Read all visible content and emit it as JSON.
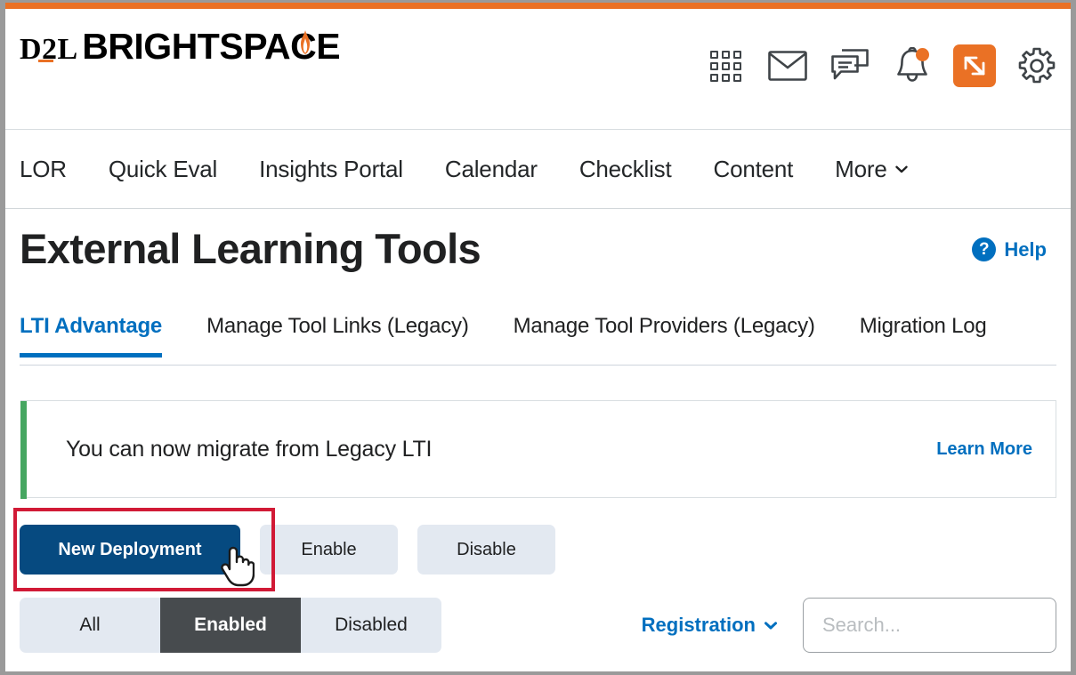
{
  "brand": {
    "logo_primary": "D2L",
    "logo_secondary": "BRIGHTSPACE",
    "accent_color": "#ea7125"
  },
  "header": {
    "icons": [
      {
        "name": "waffle-grid-icon",
        "label": "Course Selector"
      },
      {
        "name": "envelope-icon",
        "label": "Email"
      },
      {
        "name": "chat-bubbles-icon",
        "label": "Subscriptions"
      },
      {
        "name": "bell-icon",
        "label": "Notifications",
        "badge": true
      },
      {
        "name": "app-switcher-icon",
        "label": "App Switcher",
        "active": true
      },
      {
        "name": "gear-icon",
        "label": "Settings"
      }
    ]
  },
  "nav": {
    "items": [
      {
        "label": "LOR"
      },
      {
        "label": "Quick Eval"
      },
      {
        "label": "Insights Portal"
      },
      {
        "label": "Calendar"
      },
      {
        "label": "Checklist"
      },
      {
        "label": "Content"
      }
    ],
    "more_label": "More"
  },
  "page": {
    "title": "External Learning Tools",
    "help_label": "Help"
  },
  "tabs": [
    {
      "label": "LTI Advantage",
      "active": true
    },
    {
      "label": "Manage Tool Links (Legacy)",
      "active": false
    },
    {
      "label": "Manage Tool Providers (Legacy)",
      "active": false
    },
    {
      "label": "Migration Log",
      "active": false
    }
  ],
  "banner": {
    "message": "You can now migrate from Legacy LTI",
    "action_label": "Learn More",
    "accent_color": "#46a661"
  },
  "actions": {
    "primary": {
      "label": "New Deployment",
      "highlighted": true,
      "color": "#064a80"
    },
    "secondary": [
      {
        "label": "Enable"
      },
      {
        "label": "Disable"
      }
    ]
  },
  "filters": {
    "segments": [
      {
        "label": "All",
        "selected": false
      },
      {
        "label": "Enabled",
        "selected": true
      },
      {
        "label": "Disabled",
        "selected": false
      }
    ],
    "registration_label": "Registration",
    "search": {
      "value": "",
      "placeholder": "Search..."
    }
  },
  "annotation": {
    "highlight_color": "#d11a36",
    "target": "New Deployment"
  }
}
